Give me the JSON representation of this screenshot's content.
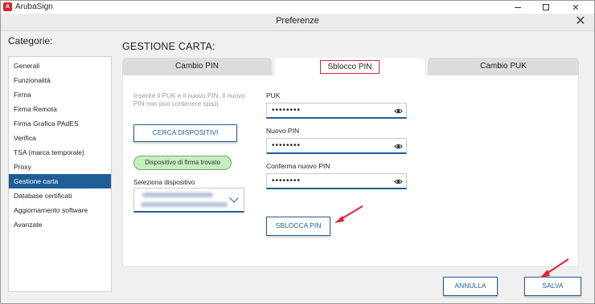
{
  "app": {
    "name": "ArubaSign",
    "icon": "arubasign-logo-icon"
  },
  "dialog": {
    "title": "Preferenze",
    "close_icon": "close-icon"
  },
  "sidebar": {
    "title": "Categorie:",
    "items": [
      {
        "label": "Generali"
      },
      {
        "label": "Funzionalità"
      },
      {
        "label": "Firma"
      },
      {
        "label": "Firma Remota"
      },
      {
        "label": "Firma Grafica PAdES"
      },
      {
        "label": "Verifica"
      },
      {
        "label": "TSA (marca temporale)"
      },
      {
        "label": "Proxy"
      },
      {
        "label": "Gestione carta",
        "active": true
      },
      {
        "label": "Database certificati"
      },
      {
        "label": "Aggiornamento software"
      },
      {
        "label": "Avanzate"
      }
    ]
  },
  "main": {
    "section_title": "GESTIONE CARTA:",
    "tabs": [
      {
        "label": "Cambio PIN",
        "active": false
      },
      {
        "label": "Sblocco PIN",
        "active": true
      },
      {
        "label": "Cambio PUK",
        "active": false
      }
    ],
    "instructions": "Inserire il PUK e il nuovo PIN. Il nuovo PIN non può contenere spazi",
    "search_button": "CERCA DISPOSITIVI",
    "status": "Dispositivo di firma trovato",
    "device_label": "Seleziona dispositivo",
    "fields": {
      "puk": {
        "label": "PUK",
        "value": "••••••••"
      },
      "new_pin": {
        "label": "Nuovo PIN",
        "value": "••••••••"
      },
      "confirm_pin": {
        "label": "Conferma nuovo PIN",
        "value": "••••••••"
      }
    },
    "unlock_button": "SBLOCCA PIN"
  },
  "footer": {
    "cancel_button": "ANNULLA",
    "save_button": "SALVA"
  },
  "colors": {
    "accent": "#1f5e96",
    "highlight_red": "#d9243a",
    "status_green_bg": "#c9ecc4",
    "status_green_border": "#63b35a"
  }
}
